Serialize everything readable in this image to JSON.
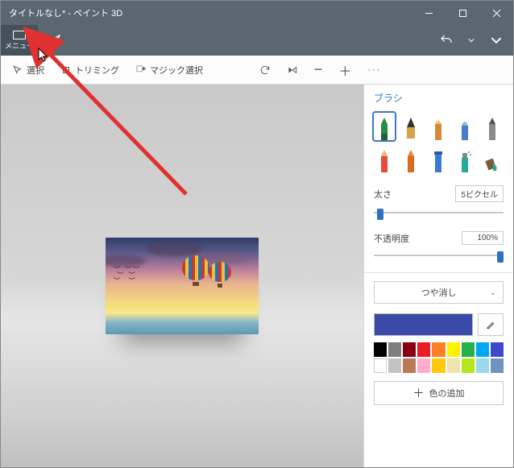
{
  "title": "タイトルなし* - ペイント 3D",
  "menu_label": "メニュー",
  "toolbar": {
    "select": "選択",
    "crop": "トリミング",
    "magic": "マジック選択"
  },
  "side": {
    "heading": "ブラシ",
    "thickness_label": "太さ",
    "thickness_value": "5ピクセル",
    "opacity_label": "不透明度",
    "opacity_value": "100%",
    "finish_label": "つや消し",
    "add_color": "色の追加"
  },
  "palette_row1": [
    "#000000",
    "#7f7f7f",
    "#870014",
    "#ec1c24",
    "#ff7f27",
    "#fef200",
    "#22b14c",
    "#00a8f3",
    "#3f48cc"
  ],
  "palette_row2": [
    "#ffffff",
    "#c3c3c3",
    "#b97a56",
    "#ffadc8",
    "#ffc90d",
    "#efe3af",
    "#b5e61d",
    "#9ad9ea",
    "#7092be"
  ],
  "current_color": "#3a4aa7"
}
